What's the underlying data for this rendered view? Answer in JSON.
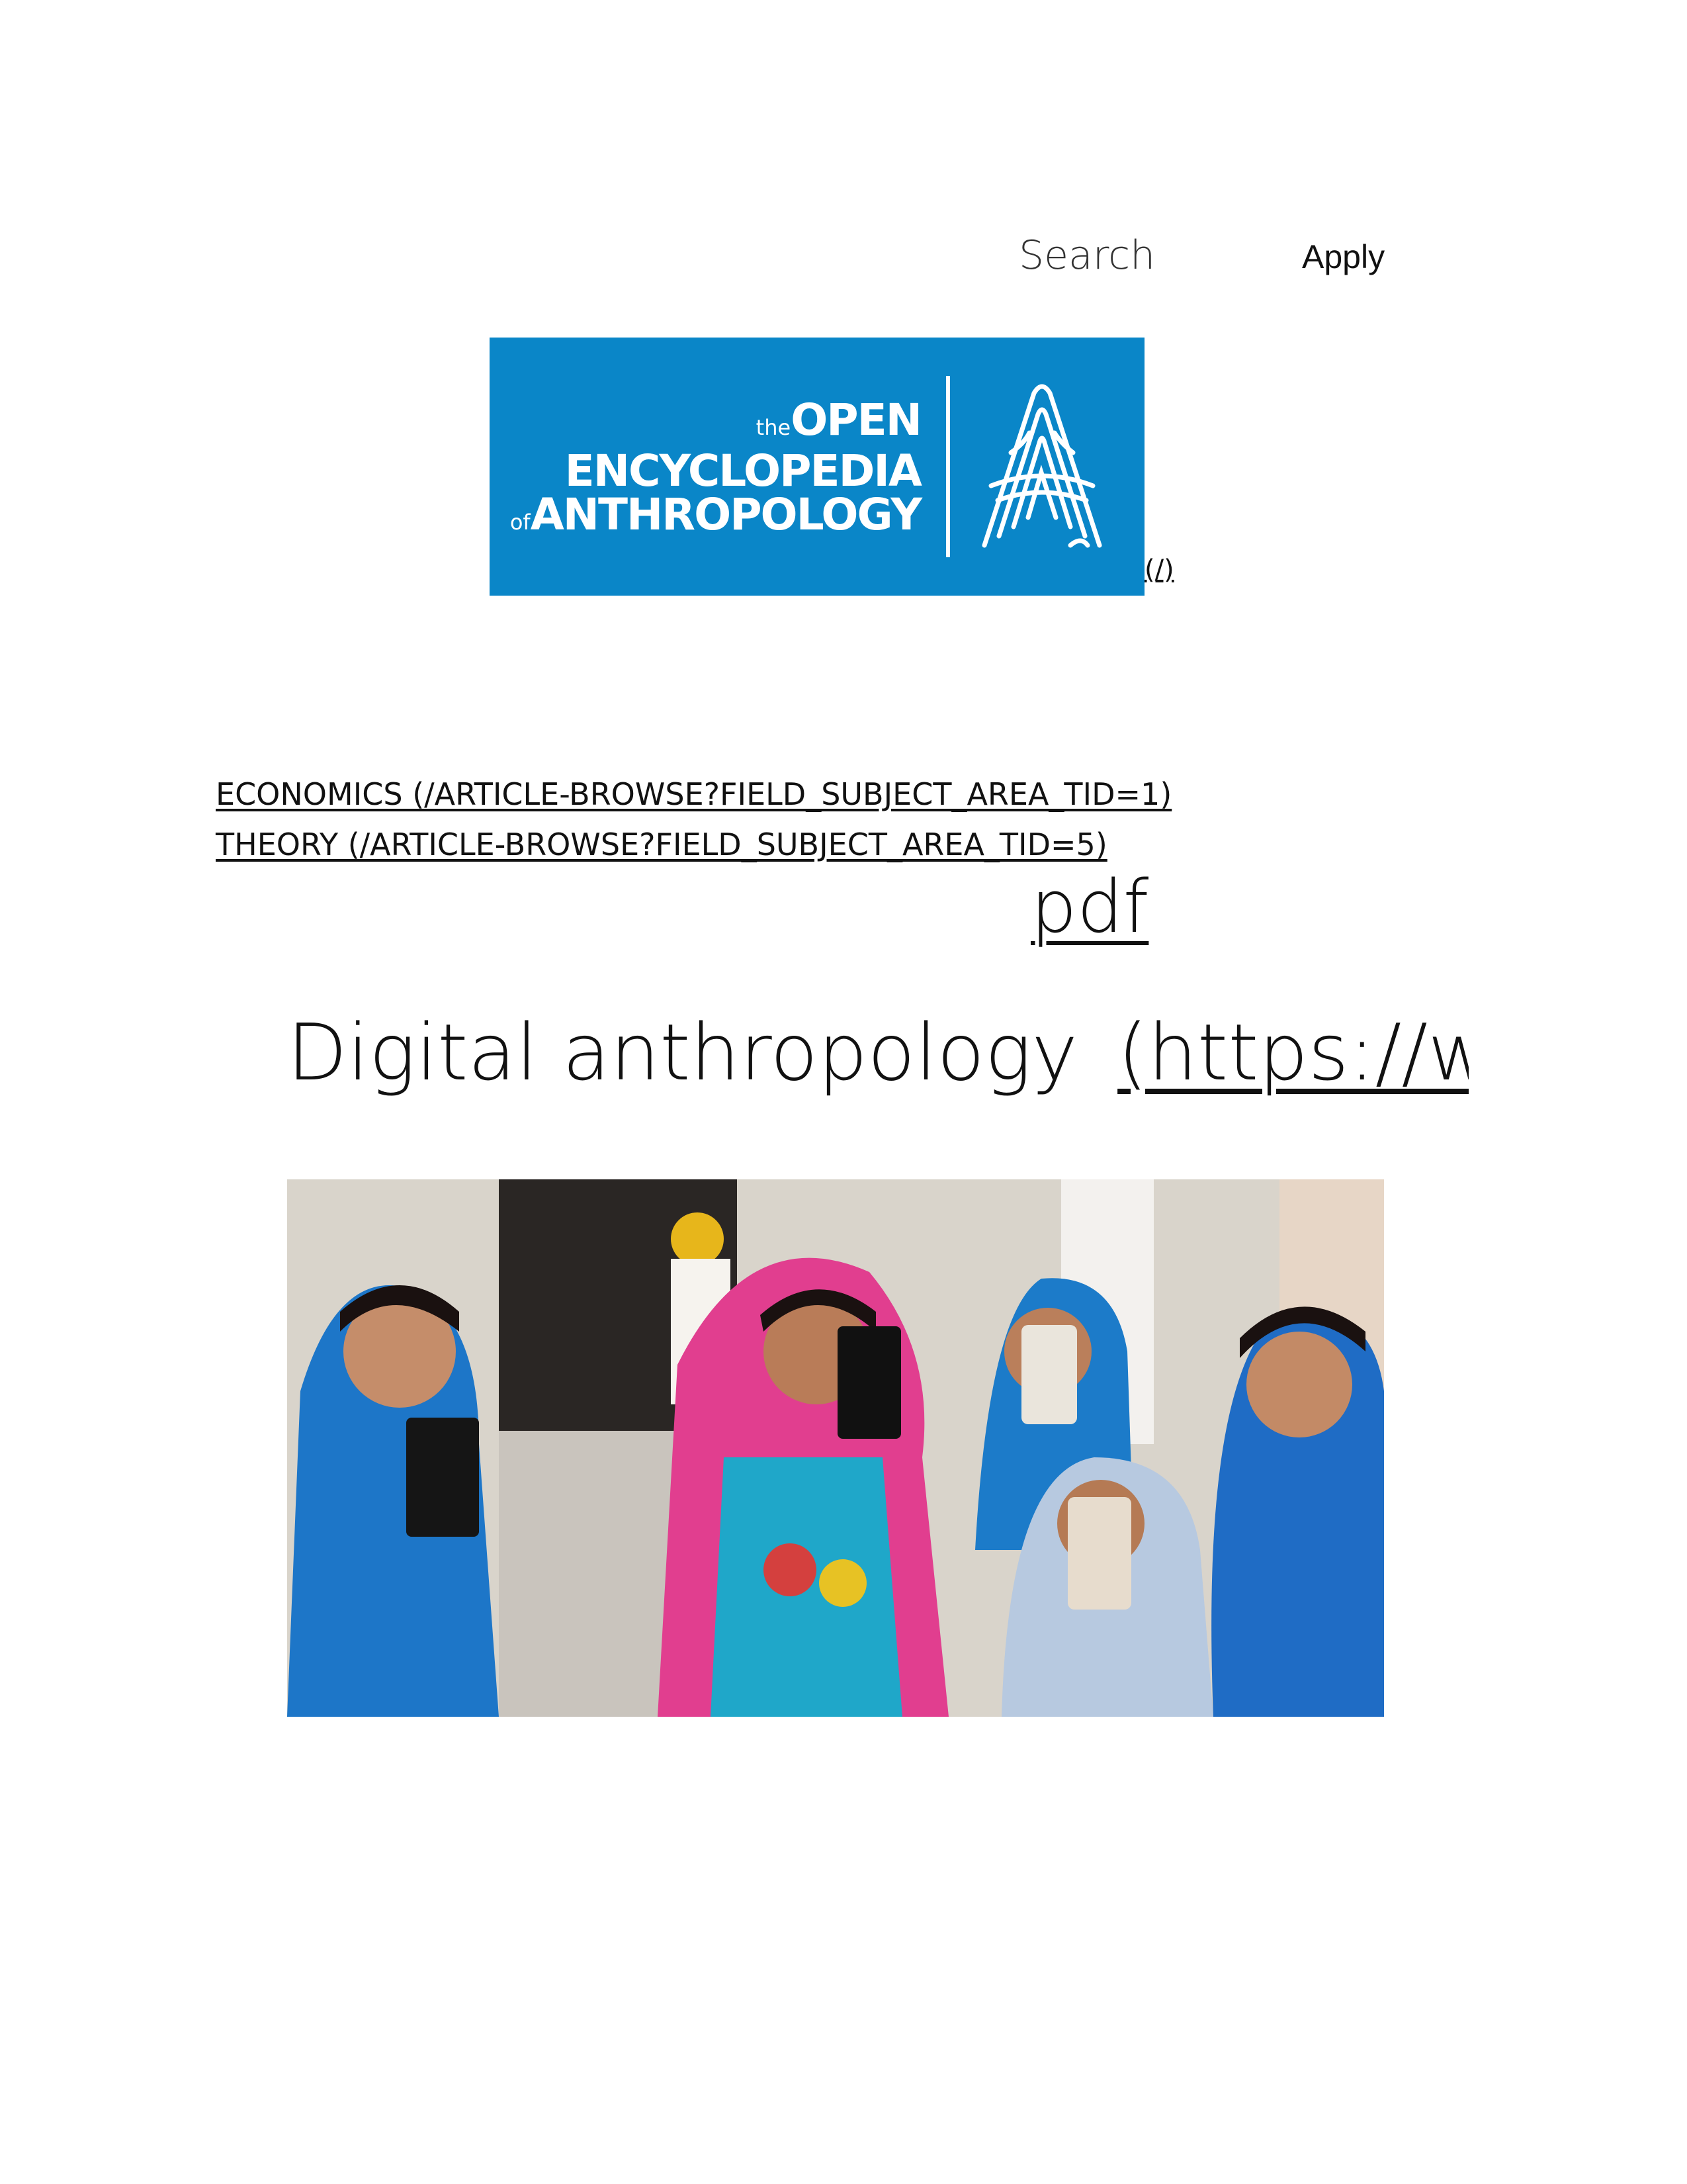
{
  "search": {
    "placeholder": "Search",
    "apply_label": "Apply"
  },
  "logo": {
    "line1_small": "the",
    "line1": "OPEN",
    "line2": "ENCYCLOPEDIA",
    "line3_small": "of",
    "line3": "ANTHROPOLOGY",
    "home_link": "(/)",
    "brand_color": "#0a86c8"
  },
  "subjects": [
    {
      "label": "ECONOMICS (/ARTICLE-BROWSE?FIELD_SUBJECT_AREA_TID=1)"
    },
    {
      "label": "THEORY (/ARTICLE-BROWSE?FIELD_SUBJECT_AREA_TID=5)"
    }
  ],
  "pdf_label": "pdf",
  "article": {
    "title": "Digital anthropology",
    "url_fragment": "(https://www"
  }
}
